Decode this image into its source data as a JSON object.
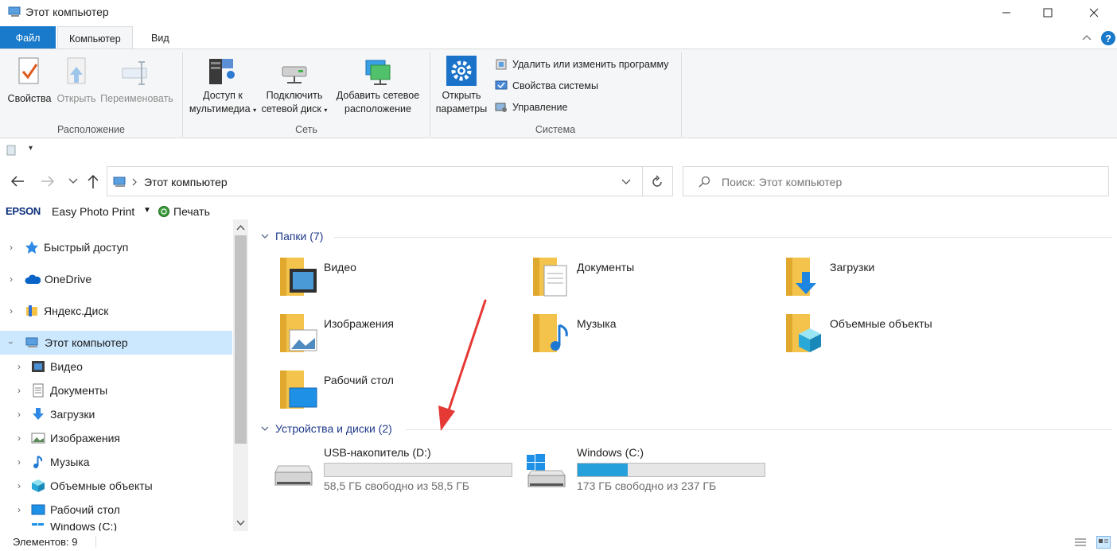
{
  "window": {
    "title": "Этот компьютер"
  },
  "tabs": {
    "file": "Файл",
    "computer": "Компьютер",
    "view": "Вид"
  },
  "ribbon": {
    "location": {
      "label": "Расположение",
      "properties": "Свойства",
      "open": "Открыть",
      "rename": "Переименовать"
    },
    "network": {
      "label": "Сеть",
      "media_line1": "Доступ к",
      "media_line2": "мультимедиа",
      "map_line1": "Подключить",
      "map_line2": "сетевой диск",
      "add_line1": "Добавить сетевое",
      "add_line2": "расположение"
    },
    "system": {
      "label": "Система",
      "settings_line1": "Открыть",
      "settings_line2": "параметры",
      "uninstall": "Удалить или изменить программу",
      "sysprops": "Свойства системы",
      "manage": "Управление"
    }
  },
  "address": {
    "path": "Этот компьютер"
  },
  "search": {
    "placeholder": "Поиск: Этот компьютер"
  },
  "epson": {
    "brand": "EPSON",
    "app": "Easy Photo Print",
    "print": "Печать"
  },
  "nav": {
    "quick": "Быстрый доступ",
    "onedrive": "OneDrive",
    "yadisk": "Яндекс.Диск",
    "thispc": "Этот компьютер",
    "children": [
      "Видео",
      "Документы",
      "Загрузки",
      "Изображения",
      "Музыка",
      "Объемные объекты",
      "Рабочий стол",
      "Windows (C:)"
    ]
  },
  "folders": {
    "header": "Папки (7)",
    "items": [
      "Видео",
      "Документы",
      "Загрузки",
      "Изображения",
      "Музыка",
      "Объемные объекты",
      "Рабочий стол"
    ]
  },
  "drives": {
    "header": "Устройства и диски (2)",
    "items": [
      {
        "name": "USB-накопитель (D:)",
        "free": "58,5 ГБ свободно из 58,5 ГБ",
        "used_fraction": 0.0
      },
      {
        "name": "Windows (C:)",
        "free": "173 ГБ свободно из 237 ГБ",
        "used_fraction": 0.27
      }
    ]
  },
  "status": {
    "count": "Элементов: 9"
  },
  "colors": {
    "accent": "#1979ca",
    "selection": "#cce8ff",
    "drive_fill": "#26a0da",
    "arrow": "#e53935"
  }
}
